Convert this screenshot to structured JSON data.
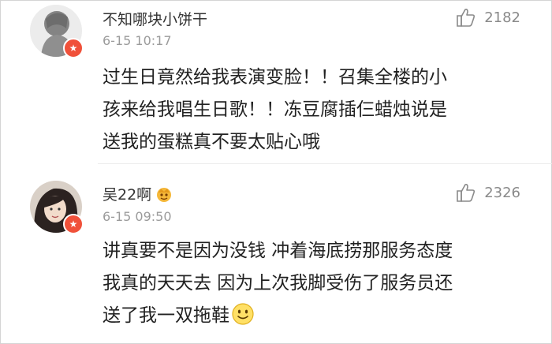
{
  "comments": [
    {
      "username": "不知哪块小饼干",
      "time": "6-15 10:17",
      "likes": "2182",
      "text_lines": [
        "过生日竟然给我表演变脸！！召集全楼的小",
        "孩来给我唱生日歌！！冻豆腐插仨蜡烛说是",
        "送我的蛋糕真不要太贴心哦"
      ],
      "badge_icon": "verified-badge-icon"
    },
    {
      "username": "吴22啊",
      "time": "6-15 09:50",
      "likes": "2326",
      "text_lines": [
        "讲真要不是因为没钱 冲着海底捞那服务态度",
        "我真的天天去 因为上次我脚受伤了服务员还",
        "送了我一双拖鞋"
      ],
      "badge_icon": "verified-badge-icon",
      "name_icon": "vip-crown-icon",
      "emoji": "smile-emoji-icon"
    }
  ],
  "colors": {
    "username": "#333333",
    "time": "#9b9b9b",
    "text": "#222222",
    "like": "#8a8a8a",
    "badge": "#f0513a"
  }
}
